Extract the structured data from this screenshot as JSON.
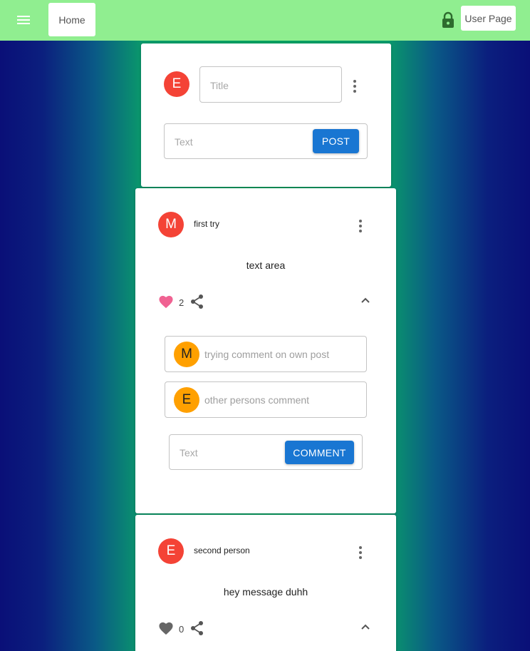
{
  "appbar": {
    "home_label": "Home",
    "userpage_label": "User Page",
    "color": "#90ee90"
  },
  "composer": {
    "avatar_initial": "E",
    "title_placeholder": "Title",
    "text_placeholder": "Text",
    "post_label": "POST"
  },
  "posts": [
    {
      "avatar_initial": "M",
      "author": "first try",
      "body": "text area",
      "likes": "2",
      "liked": true,
      "comments": [
        {
          "avatar_initial": "M",
          "text": "trying comment on own post"
        },
        {
          "avatar_initial": "E",
          "text": "other persons comment"
        }
      ],
      "comment_placeholder": "Text",
      "comment_button": "COMMENT"
    },
    {
      "avatar_initial": "E",
      "author": "second person",
      "body": "hey message duhh",
      "likes": "0",
      "liked": false
    }
  ],
  "colors": {
    "avatar_red": "#f44336",
    "avatar_orange": "#ffa000",
    "button_blue": "#1976d2",
    "heart_pink": "#f06292"
  }
}
